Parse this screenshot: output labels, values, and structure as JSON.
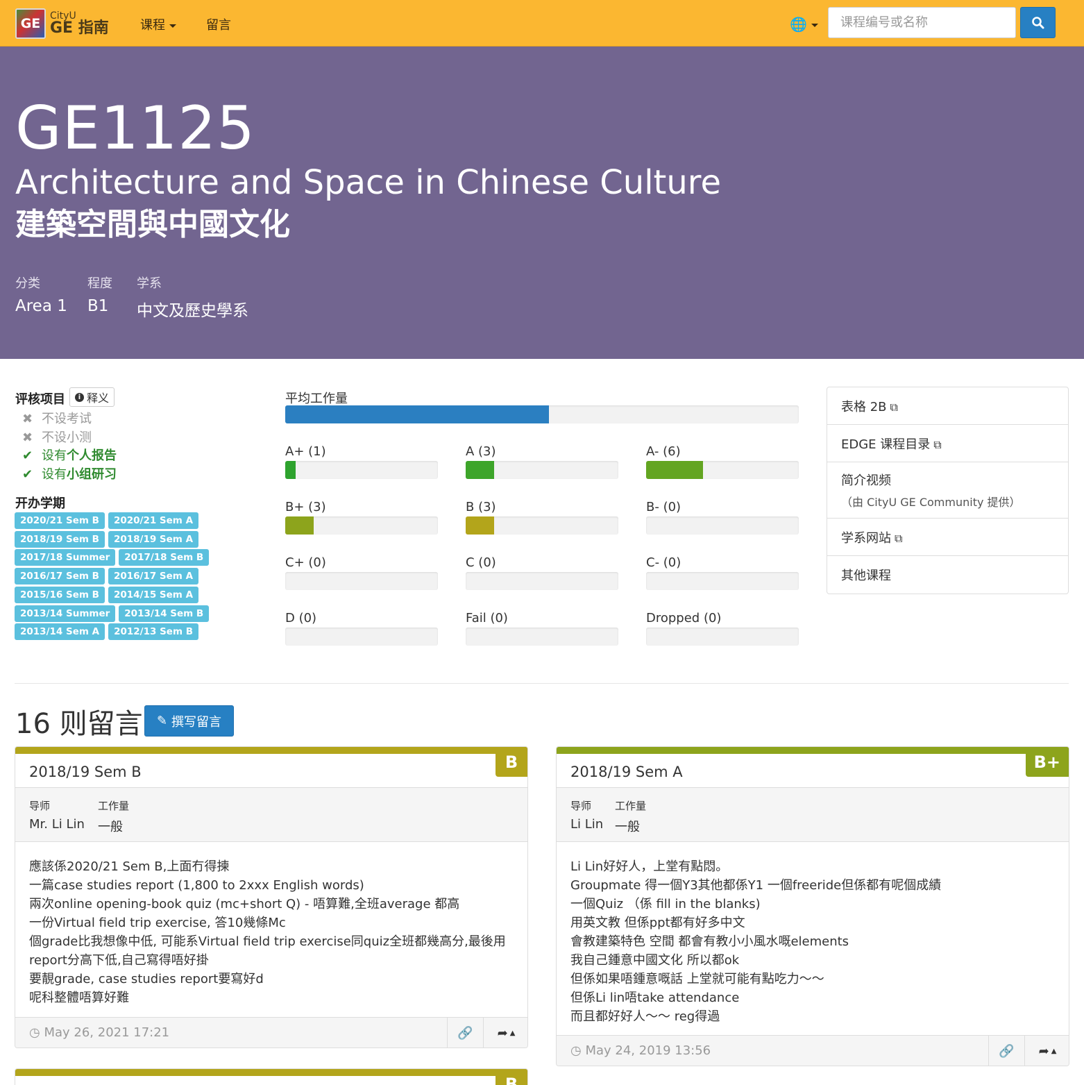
{
  "nav": {
    "logo_box": "GE",
    "logo_cityu": "CityU",
    "logo_ge": "GE 指南",
    "courses": "课程",
    "comments": "留言",
    "language_icon": "globe-icon",
    "search_placeholder": "课程编号或名称"
  },
  "course": {
    "code": "GE1125",
    "title_en": "Architecture and Space in Chinese Culture",
    "title_zh": "建築空間與中國文化",
    "meta": [
      {
        "label": "分类",
        "value": "Area 1"
      },
      {
        "label": "程度",
        "value": "B1"
      },
      {
        "label": "学系",
        "value": "中文及歷史學系"
      }
    ]
  },
  "assessment": {
    "heading": "评核项目",
    "explain": "释义",
    "items": [
      {
        "prefix": "不设",
        "emph": "考试",
        "present": false
      },
      {
        "prefix": "不设",
        "emph": "小测",
        "present": false
      },
      {
        "prefix": "设有",
        "emph": "个人报告",
        "present": true
      },
      {
        "prefix": "设有",
        "emph": "小组研习",
        "present": true
      }
    ]
  },
  "semesters": {
    "heading": "开办学期",
    "list": [
      "2020/21 Sem B",
      "2020/21 Sem A",
      "2018/19 Sem B",
      "2018/19 Sem A",
      "2017/18 Summer",
      "2017/18 Sem B",
      "2016/17 Sem B",
      "2016/17 Sem A",
      "2015/16 Sem B",
      "2014/15 Sem A",
      "2013/14 Summer",
      "2013/14 Sem B",
      "2013/14 Sem A",
      "2012/13 Sem B"
    ]
  },
  "workload": {
    "label": "平均工作量",
    "fraction": 0.514,
    "color": "#2b7fc1"
  },
  "grades": [
    {
      "label": "A+ (1)",
      "fraction": 0.067,
      "color": "#2ea32e"
    },
    {
      "label": "A (3)",
      "fraction": 0.186,
      "color": "#3da52a"
    },
    {
      "label": "A- (6)",
      "fraction": 0.373,
      "color": "#63a521"
    },
    {
      "label": "B+ (3)",
      "fraction": 0.186,
      "color": "#8da41c"
    },
    {
      "label": "B (3)",
      "fraction": 0.186,
      "color": "#b3a51b"
    },
    {
      "label": "B- (0)",
      "fraction": 0,
      "color": "#c5a21a"
    },
    {
      "label": "C+ (0)",
      "fraction": 0,
      "color": "#d99a1a"
    },
    {
      "label": "C (0)",
      "fraction": 0,
      "color": "#e08a1a"
    },
    {
      "label": "C- (0)",
      "fraction": 0,
      "color": "#e3741a"
    },
    {
      "label": "D (0)",
      "fraction": 0,
      "color": "#d9531e"
    },
    {
      "label": "Fail (0)",
      "fraction": 0,
      "color": "#d9361e"
    },
    {
      "label": "Dropped (0)",
      "fraction": 0,
      "color": "#999999"
    }
  ],
  "side_links": [
    {
      "label": "表格 2B",
      "external": true,
      "sub": ""
    },
    {
      "label": "EDGE 课程目录",
      "external": true,
      "sub": ""
    },
    {
      "label": "简介视频",
      "external": false,
      "sub": "（由 CityU GE Community 提供）"
    },
    {
      "label": "学系网站",
      "external": true,
      "sub": ""
    },
    {
      "label": "其他课程",
      "external": false,
      "sub": ""
    }
  ],
  "comments": {
    "count_title": "16 则留言",
    "write_label": "撰写留言",
    "instructor_label": "导师",
    "workload_label": "工作量",
    "items": [
      {
        "semester": "2018/19 Sem B",
        "grade": "B",
        "grade_color": "#b3a51b",
        "instructor": "Mr. Li Lin",
        "workload": "一般",
        "lines": [
          "應該係2020/21 Sem B,上面冇得揀",
          "一篇case studies report (1,800 to 2xxx English words)",
          "兩次online opening-book quiz (mc+short Q) - 唔算難,全班average 都高",
          "一份Virtual field trip exercise, 答10幾條Mc",
          "個grade比我想像中低, 可能系Virtual field trip exercise同quiz全班都幾高分,最後用",
          "report分高下低,自己寫得唔好掛",
          "要靚grade, case studies report要寫好d",
          "呢科整體唔算好難"
        ],
        "time": "May 26, 2021 17:21"
      },
      {
        "semester": "2018/19 Sem A",
        "grade": "B+",
        "grade_color": "#8da41c",
        "instructor": "Li Lin",
        "workload": "一般",
        "lines": [
          "Li Lin好好人，上堂有點悶。",
          "Groupmate 得一個Y3其他都係Y1 一個freeride但係都有呢個成績",
          "一個Quiz （係 fill in the blanks)",
          "用英文教 但係ppt都有好多中文",
          "會教建築特色 空間 都會有教小小風水嘅elements",
          "我自己鍾意中國文化 所以都ok",
          "但係如果唔鍾意嘅話 上堂就可能有點吃力～～",
          "但係Li lin唔take attendance",
          "而且都好好人～～ reg得過"
        ],
        "time": "May 24, 2019 13:56"
      },
      {
        "grade": "B",
        "grade_color": "#b3a51b"
      }
    ]
  }
}
